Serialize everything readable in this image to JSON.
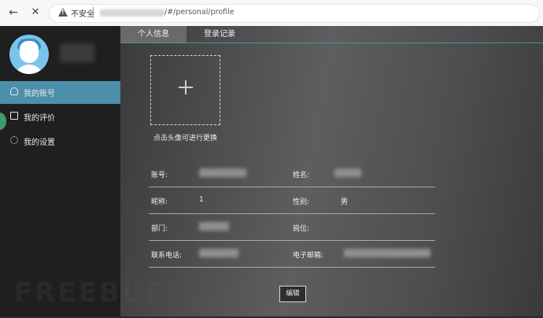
{
  "browser": {
    "insecure_label": "不安全",
    "url_suffix": "/#/personal/profile"
  },
  "sidebar": {
    "items": [
      {
        "label": "我的账号",
        "icon": "user-icon",
        "active": true
      },
      {
        "label": "我的评价",
        "icon": "comment-icon",
        "active": false
      },
      {
        "label": "我的设置",
        "icon": "gear-icon",
        "active": false
      }
    ]
  },
  "tabs": [
    {
      "label": "个人信息",
      "active": true
    },
    {
      "label": "登录记录",
      "active": false
    }
  ],
  "avatar_upload": {
    "hint": "点击头像可进行更换"
  },
  "profile": {
    "account_label": "账号:",
    "name_label": "姓名:",
    "nickname_label": "昵称:",
    "nickname_value": "1",
    "gender_label": "性别:",
    "gender_value": "男",
    "department_label": "部门:",
    "position_label": "岗位:",
    "phone_label": "联系电话:",
    "email_label": "电子邮箱:"
  },
  "actions": {
    "edit_label": "编辑"
  },
  "watermark": "FREEBUF",
  "colors": {
    "accent": "#4b8fab",
    "sidebar_bg": "#1f1f1f"
  }
}
